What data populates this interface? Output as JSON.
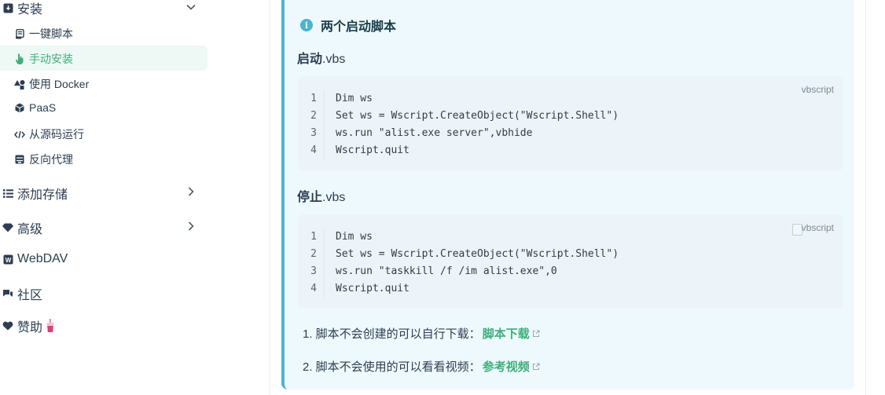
{
  "sidebar": {
    "install": {
      "label": "安装"
    },
    "install_items": [
      {
        "label": "一键脚本"
      },
      {
        "label": "手动安装"
      },
      {
        "label": "使用 Docker"
      },
      {
        "label": "PaaS"
      },
      {
        "label": "从源码运行"
      },
      {
        "label": "反向代理"
      }
    ],
    "add_storage": {
      "label": "添加存储"
    },
    "advanced": {
      "label": "高级"
    },
    "webdav": {
      "label": "WebDAV"
    },
    "community": {
      "label": "社区"
    },
    "sponsor": {
      "label": "赞助"
    },
    "active_color": "#3eaf7c"
  },
  "tip": {
    "title": "两个启动脚本",
    "start": {
      "heading_cn": "启动",
      "heading_ext": ".vbs",
      "lang": "vbscript",
      "lines": [
        {
          "n": "1",
          "code": "Dim ws"
        },
        {
          "n": "2",
          "code": "Set ws = Wscript.CreateObject(\"Wscript.Shell\")"
        },
        {
          "n": "3",
          "code": "ws.run \"alist.exe server\",vbhide"
        },
        {
          "n": "4",
          "code": "Wscript.quit"
        }
      ]
    },
    "stop": {
      "heading_cn": "停止",
      "heading_ext": ".vbs",
      "lang": "vbscript",
      "lines": [
        {
          "n": "1",
          "code": "Dim ws"
        },
        {
          "n": "2",
          "code": "Set ws = Wscript.CreateObject(\"Wscript.Shell\")"
        },
        {
          "n": "3",
          "code": "ws.run \"taskkill /f /im alist.exe\",0"
        },
        {
          "n": "4",
          "code": "Wscript.quit"
        }
      ]
    },
    "notes": [
      {
        "text": "1. 脚本不会创建的可以自行下载：",
        "link": "脚本下载"
      },
      {
        "text": "2. 脚本不会使用的可以看看视频：",
        "link": "参考视频"
      }
    ],
    "accent": "#4cb3d4"
  }
}
